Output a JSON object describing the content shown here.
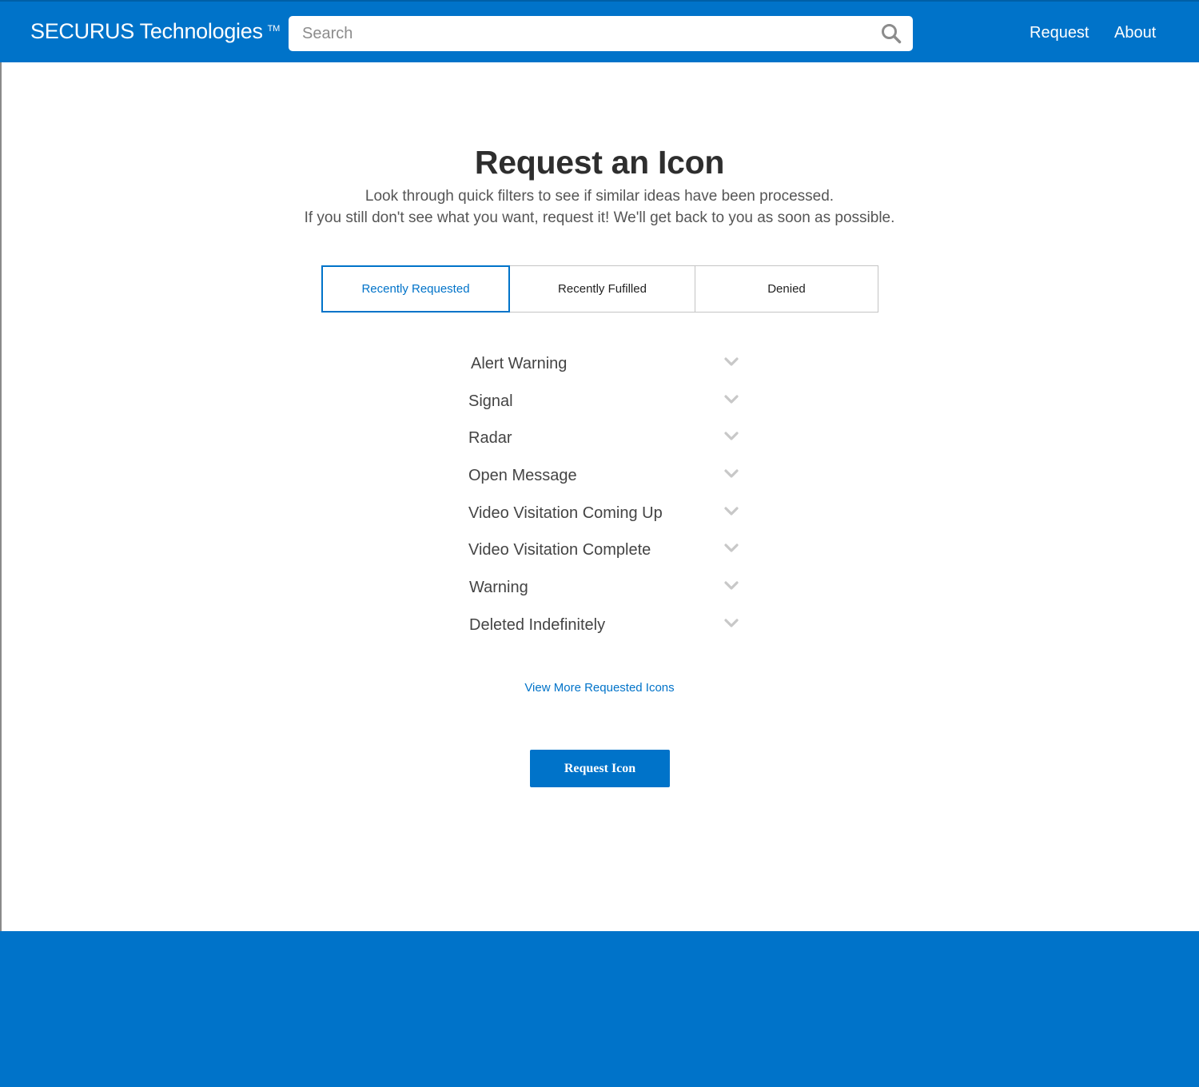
{
  "header": {
    "brand": "SECURUS Technologies",
    "trademark": "TM",
    "search_placeholder": "Search",
    "nav": {
      "request": "Request",
      "about": "About"
    }
  },
  "main": {
    "title": "Request an Icon",
    "subtitle_line1": "Look through quick filters to see if similar ideas have been processed.",
    "subtitle_line2": "If you still don't see what you want, request it! We'll get back to you as soon as possible.",
    "tabs": [
      {
        "label": "Recently Requested",
        "active": true
      },
      {
        "label": "Recently Fufilled",
        "active": false
      },
      {
        "label": "Denied",
        "active": false
      }
    ],
    "requests": [
      {
        "label": "Alert Warning"
      },
      {
        "label": "Signal"
      },
      {
        "label": "Radar"
      },
      {
        "label": "Open Message"
      },
      {
        "label": "Video Visitation Coming Up"
      },
      {
        "label": "Video Visitation Complete"
      },
      {
        "label": "Warning"
      },
      {
        "label": "Deleted Indefinitely"
      }
    ],
    "view_more": "View More Requested Icons",
    "request_button": "Request Icon"
  },
  "colors": {
    "brand_blue": "#0073c9",
    "text_dark": "#2e2e2e",
    "chevron": "#c8c8c8"
  },
  "icons": {
    "search": "search-icon",
    "expand": "chevron-down-icon"
  }
}
